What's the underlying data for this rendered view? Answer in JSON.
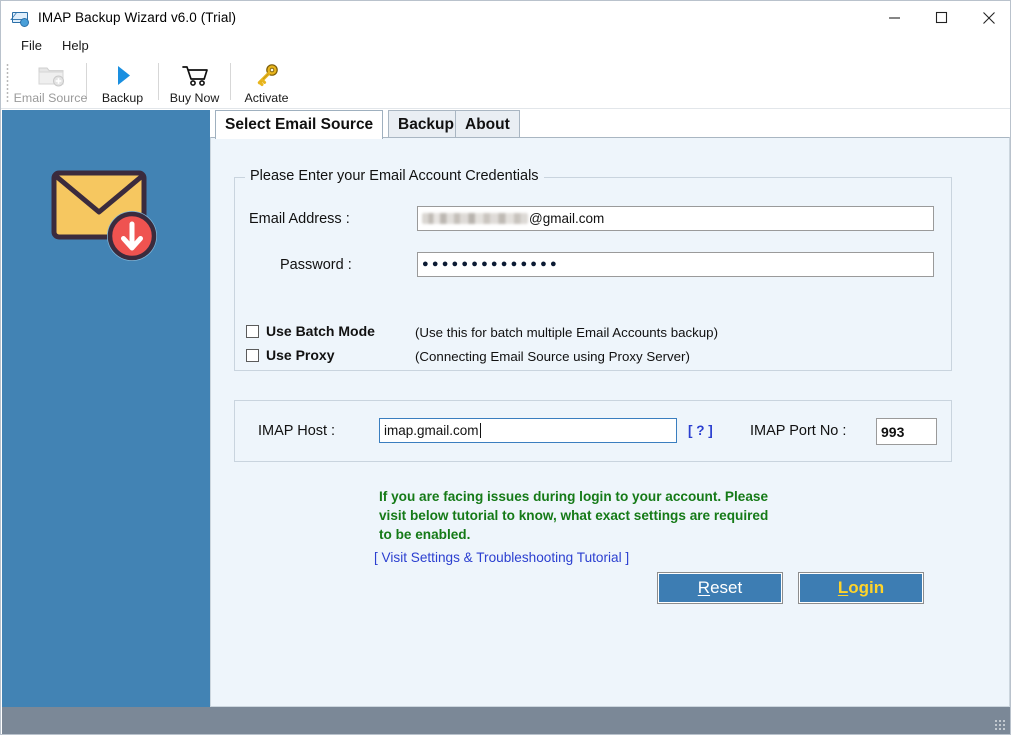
{
  "window": {
    "title": "IMAP Backup Wizard v6.0 (Trial)",
    "icon": "envelope-download-icon",
    "minimize_label": "minimize-icon",
    "maximize_label": "maximize-icon",
    "close_label": "close-icon"
  },
  "menubar": {
    "items": [
      {
        "label": "File"
      },
      {
        "label": "Help"
      }
    ]
  },
  "toolbar": {
    "buttons": [
      {
        "label": "Email Source",
        "icon": "folder-add-icon",
        "enabled": false
      },
      {
        "label": "Backup",
        "icon": "play-triangle-icon",
        "enabled": true
      },
      {
        "label": "Buy Now",
        "icon": "shopping-cart-icon",
        "enabled": true
      },
      {
        "label": "Activate",
        "icon": "key-icon",
        "enabled": true
      }
    ]
  },
  "sidebar": {
    "icon": "envelope-download-logo",
    "background_color": "#4283b4"
  },
  "tabs": [
    {
      "label": "Select Email Source",
      "active": true
    },
    {
      "label": "Backup",
      "active": false
    },
    {
      "label": "About",
      "active": false
    }
  ],
  "credentials_group": {
    "title": "Please Enter your Email Account Credentials",
    "email_label": "Email Address :",
    "email_value_visible": "@gmail.com",
    "email_value_redacted": true,
    "password_label": "Password :",
    "password_masked": "●●●●●●●●●●●●●●",
    "checkboxes": [
      {
        "label": "Use Batch Mode",
        "checked": false,
        "note": "(Use this for batch multiple Email Accounts backup)"
      },
      {
        "label": "Use Proxy",
        "checked": false,
        "note": "(Connecting Email Source using Proxy Server)"
      }
    ]
  },
  "server_group": {
    "host_label": "IMAP Host :",
    "host_value": "imap.gmail.com",
    "host_focused": true,
    "help_link": "[ ? ]",
    "port_label": "IMAP Port No :",
    "port_value": "993"
  },
  "notice": {
    "text": "If you are facing issues during login to your account. Please\nvisit below tutorial to know, what exact settings are required\nto be enabled.",
    "color": "#157a17",
    "link": "[ Visit Settings & Troubleshooting Tutorial ]",
    "link_color": "#2b3fd0"
  },
  "actions": {
    "reset": {
      "label_prefix": "",
      "label_accel": "R",
      "label_rest": "eset"
    },
    "login": {
      "label_prefix": "",
      "label_accel": "L",
      "label_rest": "ogin"
    }
  },
  "statusbar": {
    "text": "",
    "background_color": "#7b8897"
  }
}
